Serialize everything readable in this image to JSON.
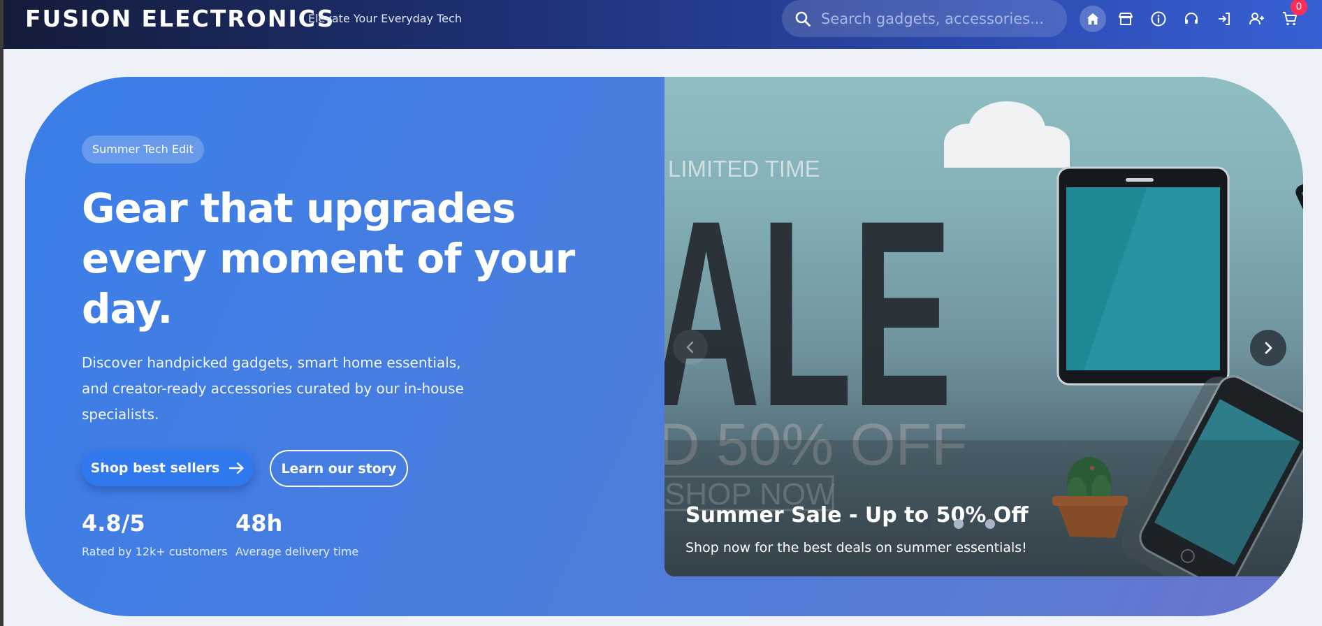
{
  "header": {
    "brand": "FUSION ELECTRONICS",
    "tagline": "Elevate Your Everyday Tech",
    "search_placeholder": "Search gadgets, accessories...",
    "nav_icons": [
      "home-icon",
      "store-icon",
      "info-icon",
      "support-icon",
      "login-icon",
      "add-user-icon",
      "cart-icon"
    ],
    "cart_count": "0"
  },
  "hero": {
    "badge": "Summer Tech Edit",
    "headline": "Gear that upgrades every moment of your day.",
    "description": "Discover handpicked gadgets, smart home essentials, and creator-ready accessories curated by our in-house specialists.",
    "primary_cta": "Shop best sellers",
    "secondary_cta": "Learn our story",
    "stats": [
      {
        "value": "4.8/5",
        "label": "Rated by 12k+ customers"
      },
      {
        "value": "48h",
        "label": "Average delivery time"
      }
    ]
  },
  "carousel": {
    "slide_caption": "Summer Sale - Up to 50% Off",
    "slide_subtitle": "Shop now for the best deals on summer essentials!",
    "slide_art_text": {
      "limited": "LIMITED TIME",
      "sale": "ALE",
      "off": "D 50% OFF",
      "shop": "SHOP NOW"
    },
    "slide_count": 3,
    "active_slide": 1
  },
  "colors": {
    "header_dark": "#141c3a",
    "header_light": "#3860d4",
    "hero_blue": "#3a7ee8",
    "primary_button": "#2f78ee",
    "badge_red": "#ff2d55"
  }
}
